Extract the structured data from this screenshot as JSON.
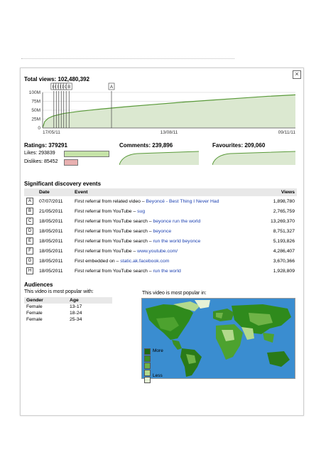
{
  "stats": {
    "total_views_label": "Total views:",
    "total_views": "102,480,392",
    "ratings_label": "Ratings:",
    "ratings": "379291",
    "likes_label": "Likes:",
    "likes": "293839",
    "dislikes_label": "Dislikes:",
    "dislikes": "85452",
    "comments_label": "Comments:",
    "comments": "239,896",
    "favourites_label": "Favourites:",
    "favourites": "209,060"
  },
  "chart_data": {
    "type": "area",
    "title": "",
    "y_ticks": [
      "100M",
      "75M",
      "50M",
      "25M",
      "0"
    ],
    "x_ticks": [
      "17/05/11",
      "13/08/11",
      "09/11/11"
    ],
    "ylim": [
      0,
      110
    ],
    "markers": [
      "H",
      "G",
      "F",
      "E",
      "D",
      "C",
      "B",
      "A"
    ],
    "x": [
      0,
      3,
      8,
      15,
      30,
      50,
      80,
      120,
      160,
      200,
      240,
      280,
      320,
      360
    ],
    "values": [
      0,
      20,
      30,
      37,
      45,
      51,
      58,
      66,
      73,
      80,
      86,
      92,
      98,
      102.5
    ],
    "color": "#5a9a3a",
    "fill": "#dbe8d0"
  },
  "events": {
    "title": "Significant discovery events",
    "columns": [
      "Date",
      "Event",
      "Views"
    ],
    "rows": [
      {
        "marker": "A",
        "date": "07/07/2011",
        "event": "First referral from related video –",
        "link": "Beyoncé - Best Thing I Never Had",
        "views": "1,898,780"
      },
      {
        "marker": "B",
        "date": "21/05/2011",
        "event": "First referral from YouTube –",
        "link": "sug",
        "views": "2,765,759"
      },
      {
        "marker": "C",
        "date": "18/05/2011",
        "event": "First referral from YouTube search –",
        "link": "beyonce run the world",
        "views": "13,269,370"
      },
      {
        "marker": "D",
        "date": "18/05/2011",
        "event": "First referral from YouTube search –",
        "link": "beyonce",
        "views": "8,751,327"
      },
      {
        "marker": "E",
        "date": "18/05/2011",
        "event": "First referral from YouTube search –",
        "link": "run the world beyonce",
        "views": "5,193,826"
      },
      {
        "marker": "F",
        "date": "18/05/2011",
        "event": "First referral from YouTube –",
        "link": "www.youtube.com/",
        "views": "4,286,407"
      },
      {
        "marker": "G",
        "date": "18/05/2011",
        "event": "First embedded on –",
        "link": "static.ak.facebook.com",
        "views": "3,670,366"
      },
      {
        "marker": "H",
        "date": "18/05/2011",
        "event": "First referral from YouTube search –",
        "link": "run the world",
        "views": "1,928,809"
      }
    ]
  },
  "audiences": {
    "title": "Audiences",
    "subtitle": "This video is most popular with:",
    "columns": [
      "Gender",
      "Age"
    ],
    "rows": [
      {
        "gender": "Female",
        "age": "13-17"
      },
      {
        "gender": "Female",
        "age": "18-24"
      },
      {
        "gender": "Female",
        "age": "25-34"
      }
    ],
    "map_title": "This video is most popular in:",
    "legend_more": "More",
    "legend_less": "Less",
    "map_colors": [
      "#1e6b12",
      "#3c8f24",
      "#6fb347",
      "#b3d98c",
      "#e6f2d6"
    ]
  },
  "close_label": "×"
}
